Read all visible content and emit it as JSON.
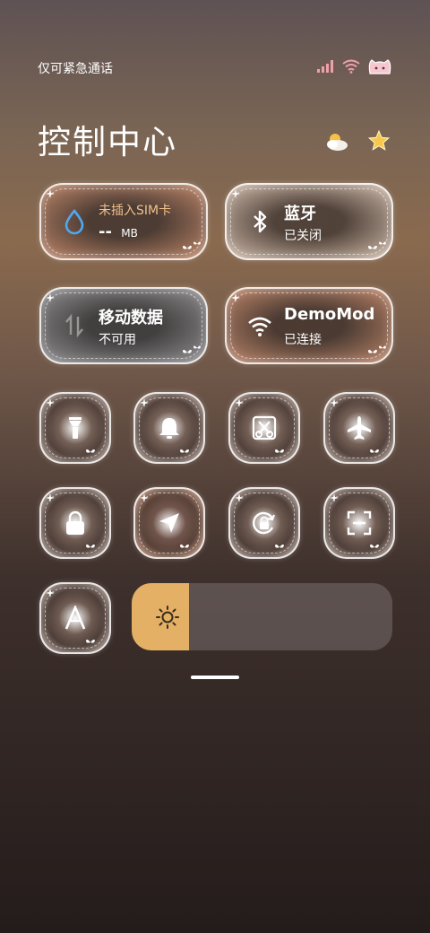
{
  "status_bar": {
    "carrier_text": "仅可紧急通话",
    "icons": [
      "signal-bars-icon",
      "wifi-icon",
      "cat-face-icon"
    ]
  },
  "header": {
    "title": "控制中心",
    "icons": [
      "weather-cloud-sun-icon",
      "star-icon"
    ]
  },
  "wide_tiles": {
    "data_usage": {
      "label": "未插入SIM卡",
      "value": "-- ",
      "unit": "MB",
      "icon": "water-drop-icon",
      "label_color": "#f2c08a",
      "icon_color": "#4fa8f0"
    },
    "bluetooth": {
      "label": "蓝牙",
      "status": "已关闭",
      "icon": "bluetooth-icon"
    },
    "mobile_data": {
      "label": "移动数据",
      "status": "不可用",
      "icon": "data-arrows-icon"
    },
    "wifi": {
      "label": "DemoMod",
      "status": "已连接",
      "icon": "wifi-icon"
    }
  },
  "toggles": [
    {
      "name": "flashlight",
      "icon": "flashlight-icon"
    },
    {
      "name": "ringer",
      "icon": "bell-icon"
    },
    {
      "name": "screenshot",
      "icon": "scissors-screenshot-icon"
    },
    {
      "name": "airplane-mode",
      "icon": "airplane-icon"
    },
    {
      "name": "lock-screen",
      "icon": "lock-icon"
    },
    {
      "name": "location",
      "icon": "location-arrow-icon"
    },
    {
      "name": "rotation-lock",
      "icon": "rotation-lock-icon"
    },
    {
      "name": "scanner",
      "icon": "scan-icon"
    },
    {
      "name": "auto-brightness",
      "icon": "letter-a-icon"
    }
  ],
  "brightness": {
    "level": 0.22,
    "icon": "sun-icon",
    "color": "#e3b066"
  }
}
